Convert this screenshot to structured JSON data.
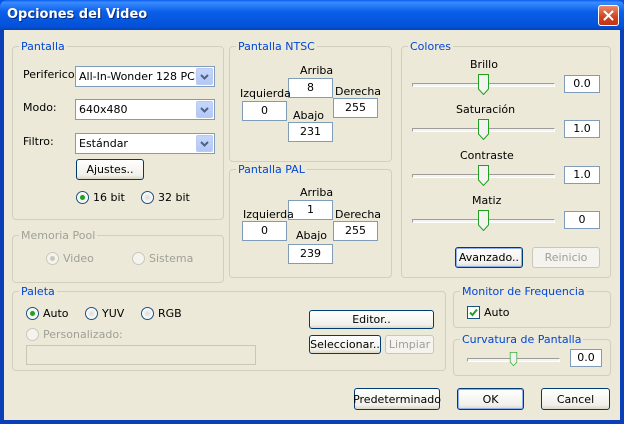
{
  "window": {
    "title": "Opciones del Video"
  },
  "pantalla": {
    "legend": "Pantalla",
    "periferico_label": "Periferico:",
    "periferico_value": "All-In-Wonder 128 PCI",
    "modo_label": "Modo:",
    "modo_value": "640x480",
    "filtro_label": "Filtro:",
    "filtro_value": "Estándar",
    "ajustes_button": "Ajustes..",
    "bit16_label": "16 bit",
    "bit32_label": "32 bit",
    "bit_selected": "16 bit"
  },
  "memoria_pool": {
    "legend": "Memoria Pool",
    "video_label": "Video",
    "sistema_label": "Sistema",
    "selected": "Video"
  },
  "ntsc": {
    "legend": "Pantalla NTSC",
    "arriba_label": "Arriba",
    "arriba_value": "8",
    "izquierda_label": "Izquierda",
    "izquierda_value": "0",
    "derecha_label": "Derecha",
    "derecha_value": "255",
    "abajo_label": "Abajo",
    "abajo_value": "231"
  },
  "pal": {
    "legend": "Pantalla PAL",
    "arriba_label": "Arriba",
    "arriba_value": "1",
    "izquierda_label": "Izquierda",
    "izquierda_value": "0",
    "derecha_label": "Derecha",
    "derecha_value": "255",
    "abajo_label": "Abajo",
    "abajo_value": "239"
  },
  "colores": {
    "legend": "Colores",
    "brillo_label": "Brillo",
    "brillo_value": "0.0",
    "brillo_level": 0.5,
    "saturacion_label": "Saturación",
    "saturacion_value": "1.0",
    "saturacion_level": 0.5,
    "contraste_label": "Contraste",
    "contraste_value": "1.0",
    "contraste_level": 0.5,
    "matiz_label": "Matiz",
    "matiz_value": "0",
    "matiz_level": 0.5,
    "avanzado_button": "Avanzado..",
    "reinicio_button": "Reinicio"
  },
  "paleta": {
    "legend": "Paleta",
    "auto_label": "Auto",
    "yuv_label": "YUV",
    "rgb_label": "RGB",
    "selected": "Auto",
    "personalizado_label": "Personalizado:",
    "personalizado_value": "",
    "editor_button": "Editor..",
    "seleccionar_button": "Seleccionar..",
    "limpiar_button": "Limpiar"
  },
  "monitor": {
    "legend": "Monitor de Frequencia",
    "auto_label": "Auto",
    "auto_checked": true
  },
  "curvatura": {
    "legend": "Curvatura de Pantalla",
    "value": "0.0",
    "level": 0.5
  },
  "footer": {
    "predeterminado_button": "Predeterminado",
    "ok_button": "OK",
    "cancel_button": "Cancel"
  },
  "colors": {
    "titlebar": "#0054e3",
    "dialog_bg": "#ece9d8",
    "group_legend": "#0046d5",
    "radio_dot": "#21a121",
    "close_button": "#d0421f"
  }
}
